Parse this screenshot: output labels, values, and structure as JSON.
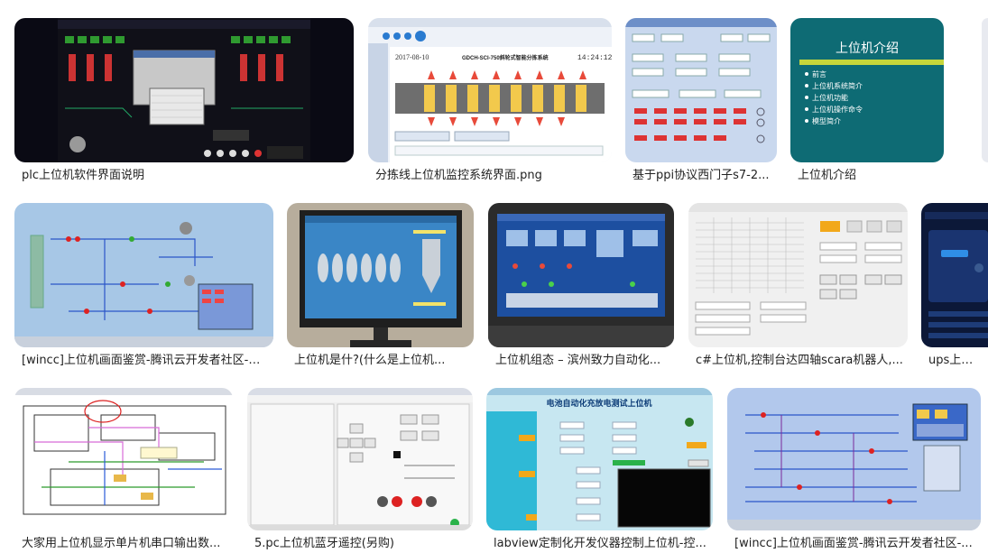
{
  "results": [
    {
      "caption": "plc上位机软件界面说明"
    },
    {
      "caption": "分拣线上位机监控系统界面.png",
      "title": "GDCH-SCI-750斜轮式智能分拣系统",
      "date": "2017-08-10",
      "time": "14:24:12"
    },
    {
      "caption": "基于ppi协议西门子s7-2..."
    },
    {
      "caption": "上位机介绍",
      "heading": "上位机介绍",
      "bullets": [
        "前言",
        "上位机系统简介",
        "上位机功能",
        "上位机操作命令",
        "模型简介"
      ]
    },
    {
      "caption": "[wincc]上位机画面鉴赏-腾讯云开发者社区-腾..."
    },
    {
      "caption": "上位机是什?(什么是上位机..."
    },
    {
      "caption": "上位机组态 – 滨州致力自动化..."
    },
    {
      "caption": "c#上位机,控制台达四轴scara机器人,..."
    },
    {
      "caption": "ups上位机"
    },
    {
      "caption": "大家用上位机显示单片机串口输出数..."
    },
    {
      "caption": "5.pc上位机蓝牙遥控(另购)"
    },
    {
      "caption": "labview定制化开发仪器控制上位机-控...",
      "title": "电池自动化充放电测试上位机"
    },
    {
      "caption": "[wincc]上位机画面鉴赏-腾讯云开发者社区-..."
    }
  ]
}
